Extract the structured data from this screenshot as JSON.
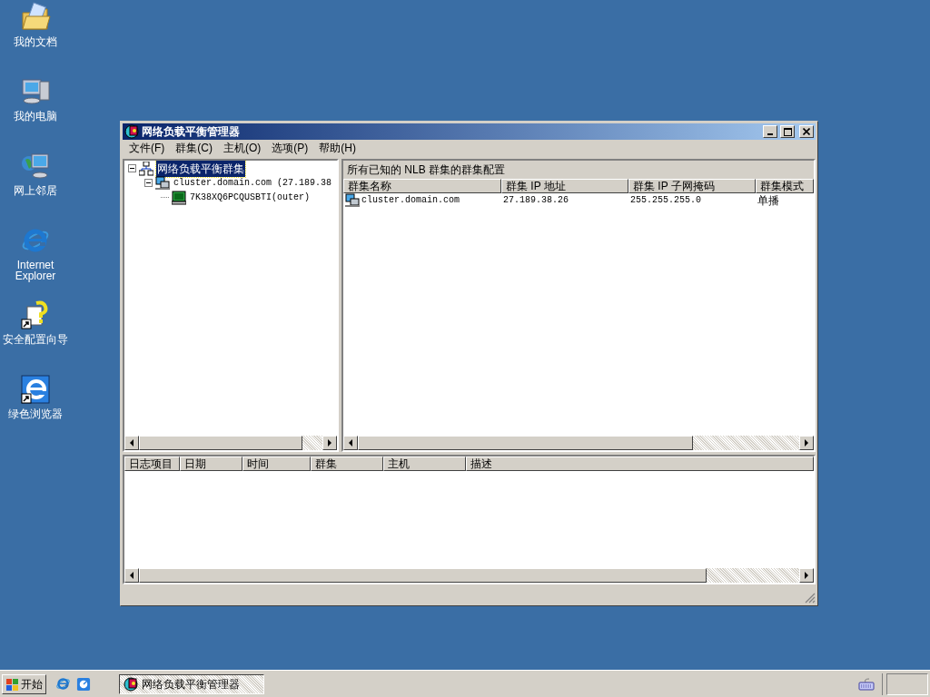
{
  "desktop_icons": [
    {
      "label": "我的文档",
      "kind": "documents"
    },
    {
      "label": "我的电脑",
      "kind": "computer"
    },
    {
      "label": "网上邻居",
      "kind": "network"
    },
    {
      "label": "Internet Explorer",
      "kind": "ie"
    },
    {
      "label": "安全配置向导",
      "kind": "wizard"
    },
    {
      "label": "绿色浏览器",
      "kind": "browser"
    }
  ],
  "window": {
    "title": "网络负载平衡管理器",
    "menu": [
      "文件(F)",
      "群集(C)",
      "主机(O)",
      "选项(P)",
      "帮助(H)"
    ],
    "tree": [
      {
        "label": "网络负载平衡群集",
        "kind": "root",
        "selected": true,
        "expanded": true,
        "children": [
          {
            "label": "cluster.domain.com (27.189.38",
            "kind": "cluster",
            "selected": false,
            "expanded": true,
            "children": [
              {
                "label": "7K38XQ6PCQUSBTI(outer)",
                "kind": "host",
                "selected": false
              }
            ]
          }
        ]
      }
    ],
    "detail_title": "所有已知的 NLB 群集的群集配置",
    "cluster_table": {
      "columns": [
        "群集名称",
        "群集 IP 地址",
        "群集 IP 子网掩码",
        "群集模式"
      ],
      "rows": [
        [
          "cluster.domain.com",
          "27.189.38.26",
          "255.255.255.0",
          "单播"
        ]
      ]
    },
    "log_table": {
      "columns": [
        "日志项目",
        "日期",
        "时间",
        "群集",
        "主机",
        "描述"
      ]
    }
  },
  "taskbar": {
    "start": "开始",
    "tasks": [
      {
        "label": "网络负载平衡管理器",
        "selected": true
      }
    ]
  }
}
